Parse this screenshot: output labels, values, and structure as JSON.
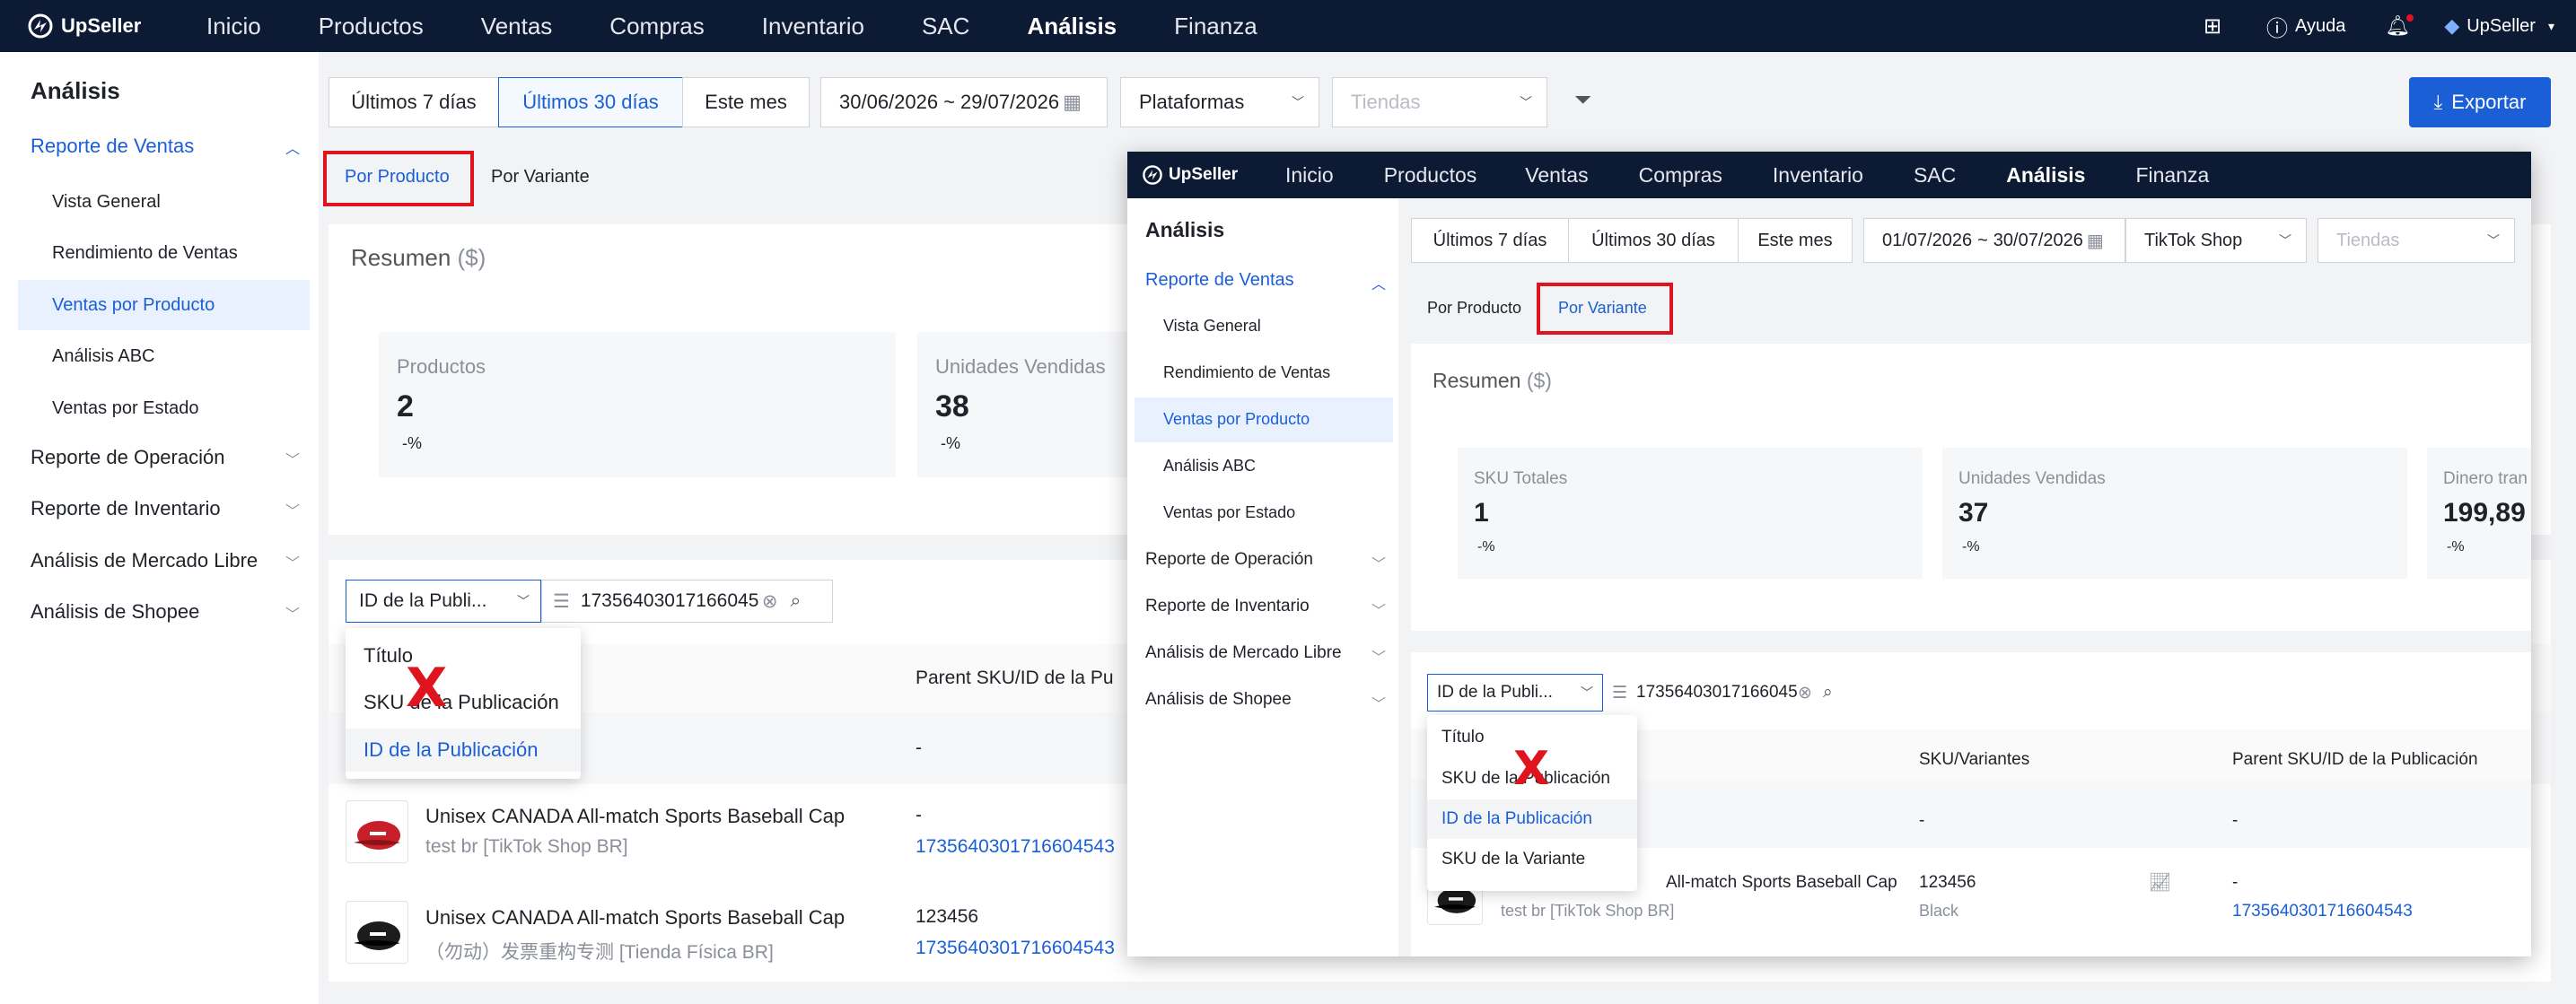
{
  "brand": "UpSeller",
  "nav": {
    "items": [
      "Inicio",
      "Productos",
      "Ventas",
      "Compras",
      "Inventario",
      "SAC",
      "Análisis",
      "Finanza"
    ],
    "active": "Análisis",
    "help": "Ayuda",
    "user": "UpSeller"
  },
  "sidebar": {
    "title": "Análisis",
    "group_sales": "Reporte de Ventas",
    "sub_items": [
      "Vista General",
      "Rendimiento de Ventas",
      "Ventas por Producto",
      "Análisis ABC",
      "Ventas por Estado"
    ],
    "selected": "Ventas por Producto",
    "groups": [
      "Reporte de Operación",
      "Reporte de Inventario",
      "Análisis de Mercado Libre",
      "Análisis de Shopee"
    ]
  },
  "main": {
    "filters": {
      "d7": "Últimos 7 días",
      "d30": "Últimos 30 días",
      "month": "Este mes",
      "date_start": "30/06/2026",
      "date_sep": "~",
      "date_end": "29/07/2026",
      "platform": "Plataformas",
      "stores_placeholder": "Tiendas"
    },
    "export": "Exportar",
    "tab_product": "Por Producto",
    "tab_variant": "Por Variante",
    "summary_title": "Resumen",
    "summary_unit": "($)",
    "cards": [
      {
        "label": "Productos",
        "value": "2",
        "change": "-%"
      },
      {
        "label": "Unidades Vendidas",
        "value": "38",
        "change": "-%"
      }
    ],
    "search_field": "ID de la Publi...",
    "search_value": "17356403017166045",
    "dropdown_options": [
      "Título",
      "SKU de la Publicación",
      "ID de la Publicación"
    ],
    "dropdown_selected": "ID de la Publicación",
    "col_parent": "Parent SKU/ID de la Pu",
    "summary_row_dash": "-",
    "rows": [
      {
        "title": "Unisex CANADA All-match Sports Baseball Cap",
        "store": "test br [TikTok Shop BR]",
        "sku": "-",
        "id": "1735640301716604543"
      },
      {
        "title": "Unisex CANADA All-match Sports Baseball Cap",
        "store": "（勿动）发票重构专测 [Tienda Física BR]",
        "sku": "123456",
        "id": "1735640301716604543"
      }
    ]
  },
  "overlay": {
    "filters": {
      "d7": "Últimos 7 días",
      "d30": "Últimos 30 días",
      "month": "Este mes",
      "date_start": "01/07/2026",
      "date_sep": "~",
      "date_end": "30/07/2026",
      "platform": "TikTok Shop",
      "stores_placeholder": "Tiendas"
    },
    "tab_product": "Por Producto",
    "tab_variant": "Por Variante",
    "summary_title": "Resumen",
    "summary_unit": "($)",
    "cards": [
      {
        "label": "SKU Totales",
        "value": "1",
        "change": "-%"
      },
      {
        "label": "Unidades Vendidas",
        "value": "37",
        "change": "-%"
      },
      {
        "label": "Dinero tran",
        "value": "199,89",
        "change": "-%"
      }
    ],
    "search_field": "ID de la Publi...",
    "search_value": "17356403017166045",
    "dropdown_options": [
      "Título",
      "SKU de la Publicación",
      "ID de la Publicación",
      "SKU de la Variante"
    ],
    "dropdown_selected": "ID de la Publicación",
    "col_sku_variants": "SKU/Variantes",
    "col_parent": "Parent SKU/ID de la Publicación",
    "summary_row_dash": "-",
    "row": {
      "title": "All-match Sports Baseball Cap",
      "store": "test br [TikTok Shop BR]",
      "sku": "123456",
      "variant": "Black",
      "parent": "-",
      "id": "1735640301716604543"
    }
  },
  "marks": {
    "x": "X"
  },
  "colors": {
    "nav_bg": "#0d1a33",
    "accent": "#1a5fd6",
    "highlight_red": "#e0141e"
  }
}
